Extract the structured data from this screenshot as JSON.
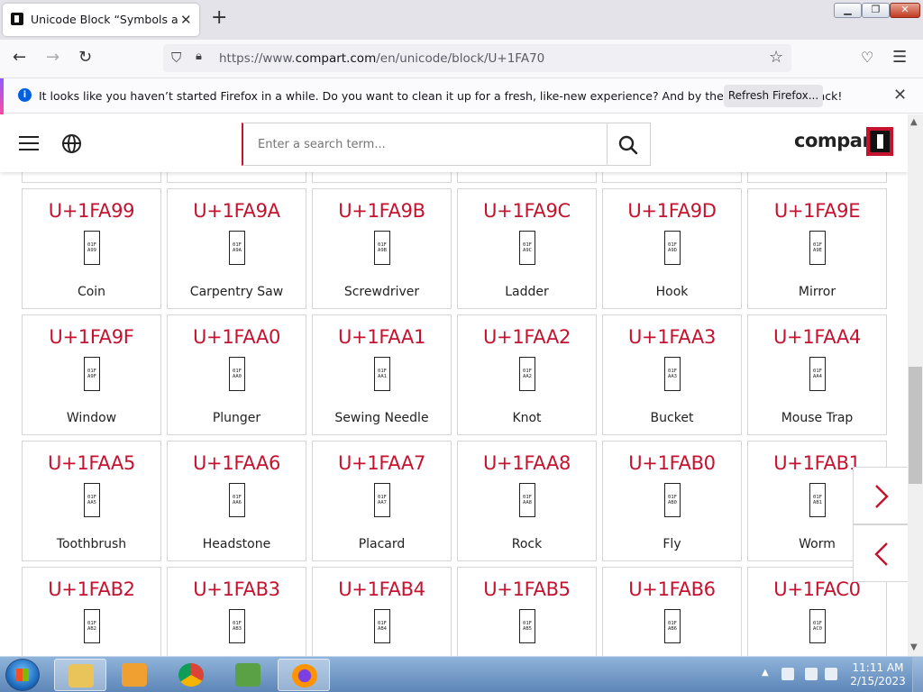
{
  "browser": {
    "tab_title": "Unicode Block “Symbols and Pi",
    "tab_close": "✕",
    "new_tab": "+",
    "url_prefix": "https://www.",
    "url_domain": "compart.com",
    "url_path": "/en/unicode/block/U+1FA70"
  },
  "notification": {
    "text": "It looks like you haven’t started Firefox in a while. Do you want to clean it up for a fresh, like-new experience? And by the way, welcome back!",
    "button_label": "Refresh Firefox...",
    "close": "✕"
  },
  "site": {
    "search_placeholder": "Enter a search term...",
    "logo": "compart"
  },
  "grid": {
    "rows": [
      [
        {
          "code": "U+1FA99",
          "hex": [
            "01F",
            "A99"
          ],
          "name": "Coin"
        },
        {
          "code": "U+1FA9A",
          "hex": [
            "01F",
            "A9A"
          ],
          "name": "Carpentry Saw"
        },
        {
          "code": "U+1FA9B",
          "hex": [
            "01F",
            "A9B"
          ],
          "name": "Screwdriver"
        },
        {
          "code": "U+1FA9C",
          "hex": [
            "01F",
            "A9C"
          ],
          "name": "Ladder"
        },
        {
          "code": "U+1FA9D",
          "hex": [
            "01F",
            "A9D"
          ],
          "name": "Hook"
        },
        {
          "code": "U+1FA9E",
          "hex": [
            "01F",
            "A9E"
          ],
          "name": "Mirror"
        }
      ],
      [
        {
          "code": "U+1FA9F",
          "hex": [
            "01F",
            "A9F"
          ],
          "name": "Window"
        },
        {
          "code": "U+1FAA0",
          "hex": [
            "01F",
            "AA0"
          ],
          "name": "Plunger"
        },
        {
          "code": "U+1FAA1",
          "hex": [
            "01F",
            "AA1"
          ],
          "name": "Sewing Needle"
        },
        {
          "code": "U+1FAA2",
          "hex": [
            "01F",
            "AA2"
          ],
          "name": "Knot"
        },
        {
          "code": "U+1FAA3",
          "hex": [
            "01F",
            "AA3"
          ],
          "name": "Bucket"
        },
        {
          "code": "U+1FAA4",
          "hex": [
            "01F",
            "AA4"
          ],
          "name": "Mouse Trap"
        }
      ],
      [
        {
          "code": "U+1FAA5",
          "hex": [
            "01F",
            "AA5"
          ],
          "name": "Toothbrush"
        },
        {
          "code": "U+1FAA6",
          "hex": [
            "01F",
            "AA6"
          ],
          "name": "Headstone"
        },
        {
          "code": "U+1FAA7",
          "hex": [
            "01F",
            "AA7"
          ],
          "name": "Placard"
        },
        {
          "code": "U+1FAA8",
          "hex": [
            "01F",
            "AA8"
          ],
          "name": "Rock"
        },
        {
          "code": "U+1FAB0",
          "hex": [
            "01F",
            "AB0"
          ],
          "name": "Fly"
        },
        {
          "code": "U+1FAB1",
          "hex": [
            "01F",
            "AB1"
          ],
          "name": "Worm"
        }
      ],
      [
        {
          "code": "U+1FAB2",
          "hex": [
            "01F",
            "AB2"
          ],
          "name": ""
        },
        {
          "code": "U+1FAB3",
          "hex": [
            "01F",
            "AB3"
          ],
          "name": ""
        },
        {
          "code": "U+1FAB4",
          "hex": [
            "01F",
            "AB4"
          ],
          "name": ""
        },
        {
          "code": "U+1FAB5",
          "hex": [
            "01F",
            "AB5"
          ],
          "name": ""
        },
        {
          "code": "U+1FAB6",
          "hex": [
            "01F",
            "AB6"
          ],
          "name": ""
        },
        {
          "code": "U+1FAC0",
          "hex": [
            "01F",
            "AC0"
          ],
          "name": ""
        }
      ]
    ]
  },
  "taskbar": {
    "time": "11:11 AM",
    "date": "2/15/2023"
  },
  "colors": {
    "accent": "#c4122f",
    "taskbar": "#6b93c3"
  },
  "icons": [
    "hamburger-icon",
    "globe-icon",
    "search-icon",
    "chevron-right-icon",
    "chevron-left-icon",
    "star-icon",
    "pocket-icon",
    "menu-icon",
    "back-icon",
    "forward-icon",
    "reload-icon",
    "shield-icon",
    "lock-icon"
  ]
}
